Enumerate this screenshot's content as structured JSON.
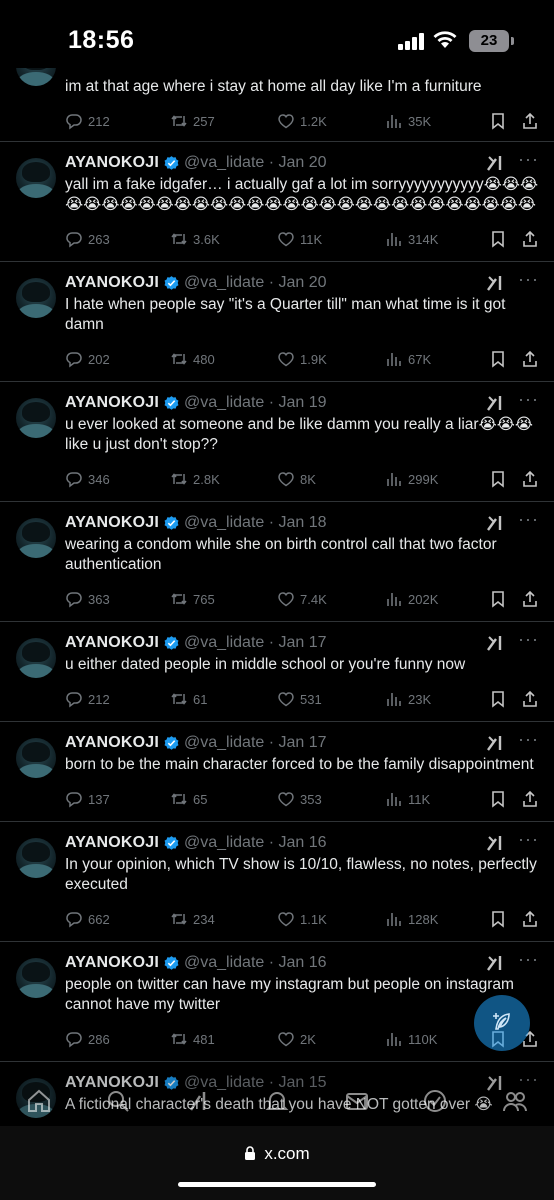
{
  "status_bar": {
    "time": "18:56",
    "battery": "23"
  },
  "tweets": [
    {
      "partial": true,
      "text": "im at that age where i stay at home all day like I'm a furniture",
      "replies": "212",
      "retweets": "257",
      "likes": "1.2K",
      "views": "35K"
    },
    {
      "name": "AYANOKOJI",
      "handle": "@va_lidate",
      "date": "Jan 20",
      "text": "yall im a fake idgafer… i actually gaf a lot im sorryyyyyyyyyyy😭😭😭😭😭😭😭😭😭😭😭😭😭😭😭😭😭😭😭😭😭😭😭😭😭😭😭😭😭",
      "replies": "263",
      "retweets": "3.6K",
      "likes": "11K",
      "views": "314K"
    },
    {
      "name": "AYANOKOJI",
      "handle": "@va_lidate",
      "date": "Jan 20",
      "text": "I hate when people say \"it's a Quarter till\" man what time is it got damn",
      "replies": "202",
      "retweets": "480",
      "likes": "1.9K",
      "views": "67K"
    },
    {
      "name": "AYANOKOJI",
      "handle": "@va_lidate",
      "date": "Jan 19",
      "text": "u ever looked at someone and be like damm you really a liar😭😭😭 like u just don't stop??",
      "replies": "346",
      "retweets": "2.8K",
      "likes": "8K",
      "views": "299K"
    },
    {
      "name": "AYANOKOJI",
      "handle": "@va_lidate",
      "date": "Jan 18",
      "text": "wearing a condom while she on birth control call that two factor authentication",
      "replies": "363",
      "retweets": "765",
      "likes": "7.4K",
      "views": "202K"
    },
    {
      "name": "AYANOKOJI",
      "handle": "@va_lidate",
      "date": "Jan 17",
      "text": "u either dated people in middle school or you're funny now",
      "replies": "212",
      "retweets": "61",
      "likes": "531",
      "views": "23K"
    },
    {
      "name": "AYANOKOJI",
      "handle": "@va_lidate",
      "date": "Jan 17",
      "text": "born to be the main character forced to be the family disappointment",
      "replies": "137",
      "retweets": "65",
      "likes": "353",
      "views": "11K"
    },
    {
      "name": "AYANOKOJI",
      "handle": "@va_lidate",
      "date": "Jan 16",
      "text": "In your opinion, which TV show is 10/10, flawless, no notes, perfectly executed",
      "replies": "662",
      "retweets": "234",
      "likes": "1.1K",
      "views": "128K"
    },
    {
      "name": "AYANOKOJI",
      "handle": "@va_lidate",
      "date": "Jan 16",
      "text": "people on twitter can have my instagram but people on instagram cannot have my twitter",
      "replies": "286",
      "retweets": "481",
      "likes": "2K",
      "views": "110K"
    },
    {
      "name": "AYANOKOJI",
      "handle": "@va_lidate",
      "date": "Jan 15",
      "text": "A fictional character's death that you have NOT gotten over 😭"
    }
  ],
  "url_bar": {
    "url": "x.com"
  },
  "colors": {
    "background": "#000000",
    "muted": "#71767b",
    "verified": "#1d9bf0",
    "divider": "#2f3336"
  }
}
